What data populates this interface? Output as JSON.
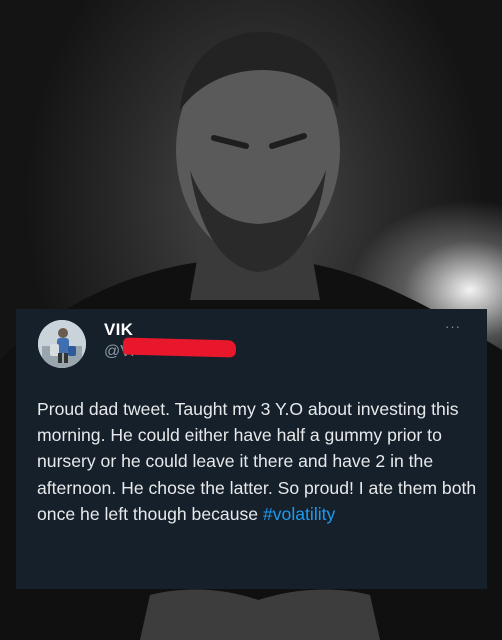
{
  "tweet": {
    "display_name": "VIK",
    "handle": "@Vi",
    "text": "Proud dad tweet. Taught my 3 Y.O about investing this morning. He could either have half a gummy prior to nursery or he could leave it there and have 2 in the afternoon. He chose the latter. So proud! I ate them both once he left though because ",
    "hashtag": "#volatility",
    "more_icon": "···"
  },
  "colors": {
    "card_background": "#15202b",
    "text": "#e7e9ea",
    "secondary_text": "#8b98a5",
    "hashtag": "#1d9bf0",
    "redaction": "#e8172c"
  },
  "icons": [
    "more-icon"
  ]
}
